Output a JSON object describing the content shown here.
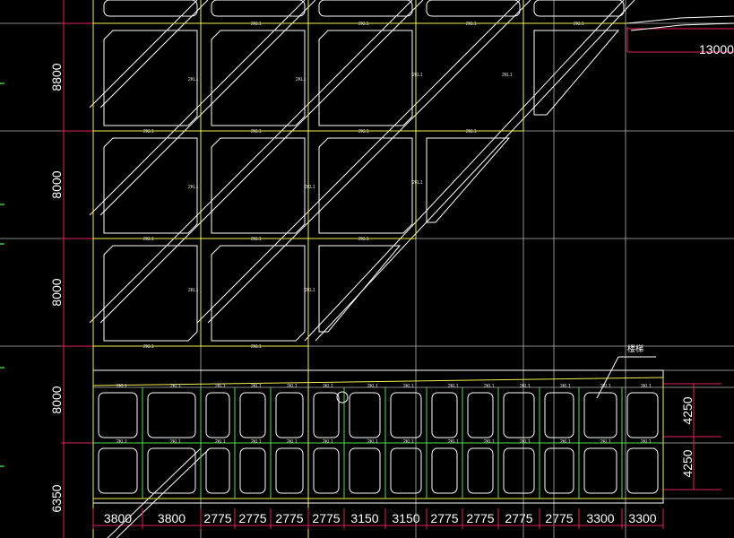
{
  "drawing": {
    "colors": {
      "background": "#000000",
      "grid": "#b4b4b4",
      "outline": "#ffffff",
      "beam": "#e6e6a0",
      "yellow_axis": "#f0f050",
      "green_axis": "#50dc50",
      "dimension": "#e02060",
      "marker": "#3cc83c"
    },
    "left_dimensions": [
      "8800",
      "8000",
      "8000",
      "8000",
      "6350"
    ],
    "bottom_dimensions": [
      "3800",
      "3800",
      "2775",
      "2775",
      "2775",
      "2775",
      "3150",
      "3150",
      "2775",
      "2775",
      "2775",
      "2775",
      "3300",
      "3300"
    ],
    "right_dimensions": [
      "4250",
      "4250"
    ],
    "top_right_dimension": "13000",
    "callout_label": "楼梯",
    "beam_label": "2KL1"
  }
}
